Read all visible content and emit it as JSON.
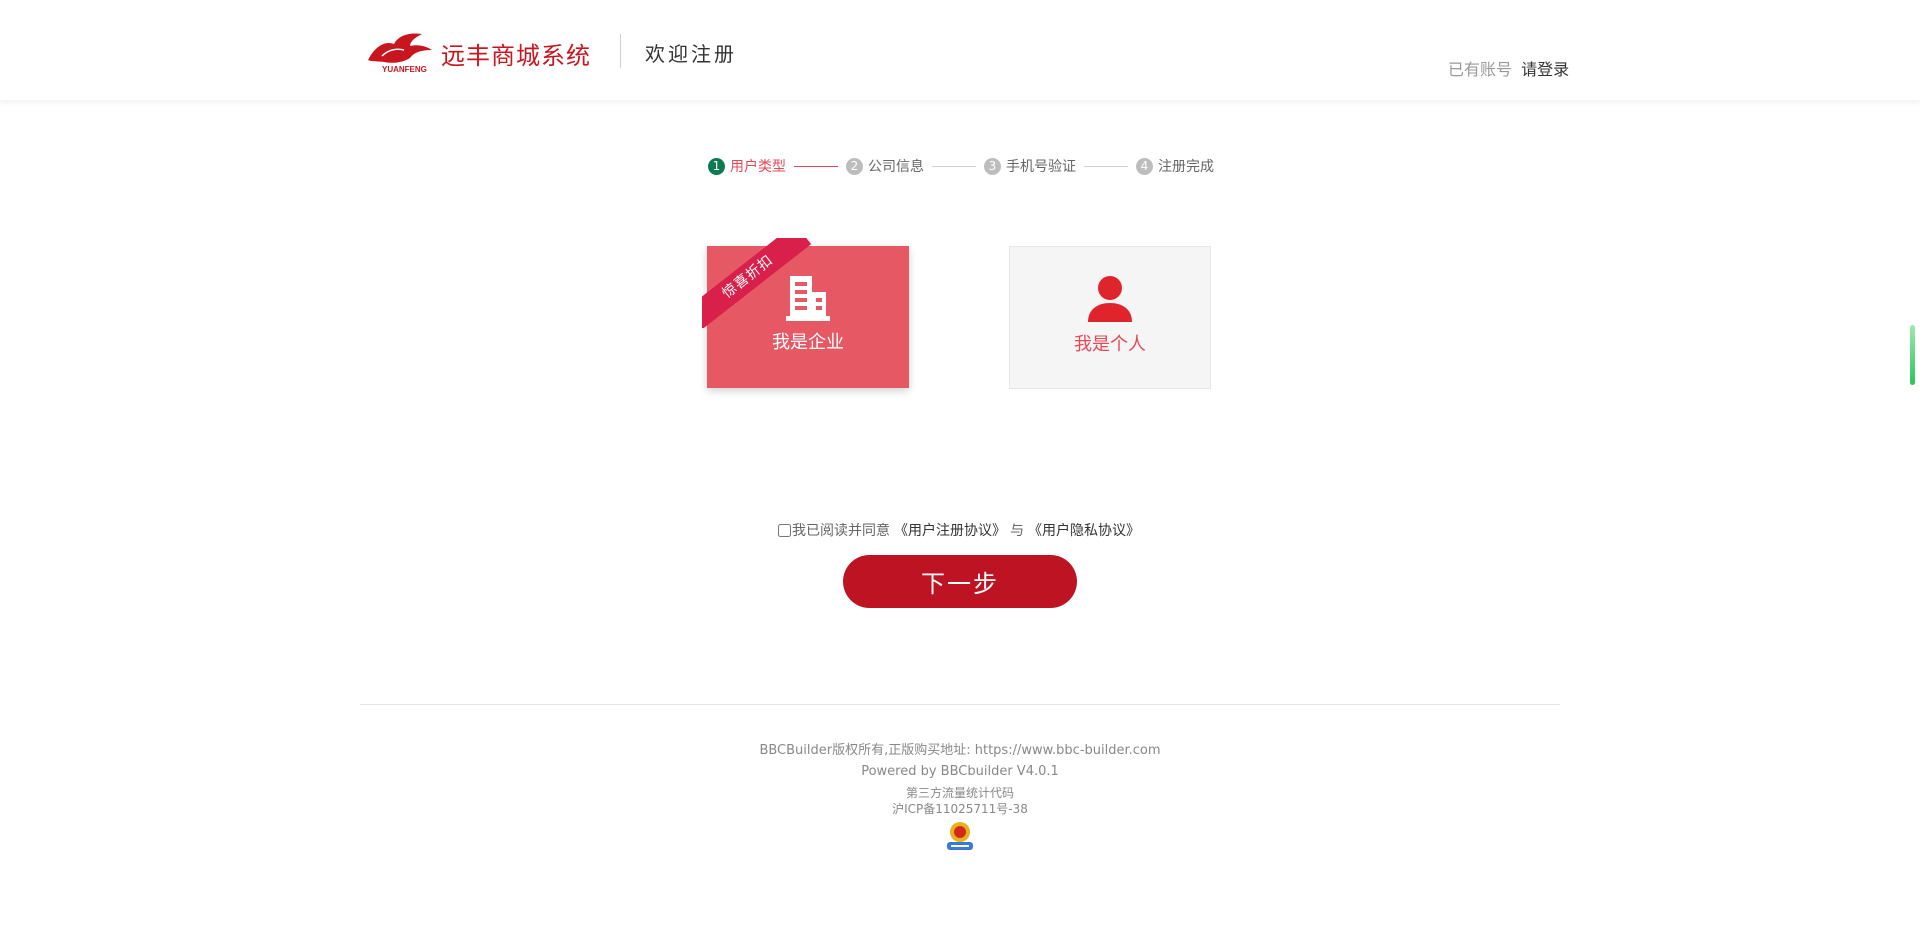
{
  "header": {
    "logo_caption": "YUANFENG",
    "site_name": "远丰商城系统",
    "welcome": "欢迎注册",
    "login_prompt": "已有账号",
    "login_link": "请登录"
  },
  "steps": [
    {
      "num": "1",
      "label": "用户类型",
      "active": true
    },
    {
      "num": "2",
      "label": "公司信息",
      "active": false
    },
    {
      "num": "3",
      "label": "手机号验证",
      "active": false
    },
    {
      "num": "4",
      "label": "注册完成",
      "active": false
    }
  ],
  "cards": {
    "company": {
      "label": "我是企业",
      "ribbon": "惊喜折扣",
      "icon": "building-icon"
    },
    "personal": {
      "label": "我是个人",
      "icon": "user-icon"
    }
  },
  "agreement": {
    "prefix": "我已阅读并同意",
    "link1": "《用户注册协议》",
    "conj": "与",
    "link2": "《用户隐私协议》",
    "checked": false
  },
  "next_button": "下一步",
  "footer": {
    "copyright": "BBCBuilder版权所有,正版购买地址: https://www.bbc-builder.com",
    "powered": "Powered by BBCbuilder V4.0.1",
    "stats": "第三方流量统计代码",
    "icp": "沪ICP备11025711号-38",
    "badge_icon": "police-badge-icon"
  },
  "colors": {
    "brand_red": "#c8161e",
    "accent": "#e84855",
    "active_step": "#0e7a52",
    "button": "#be1322"
  }
}
